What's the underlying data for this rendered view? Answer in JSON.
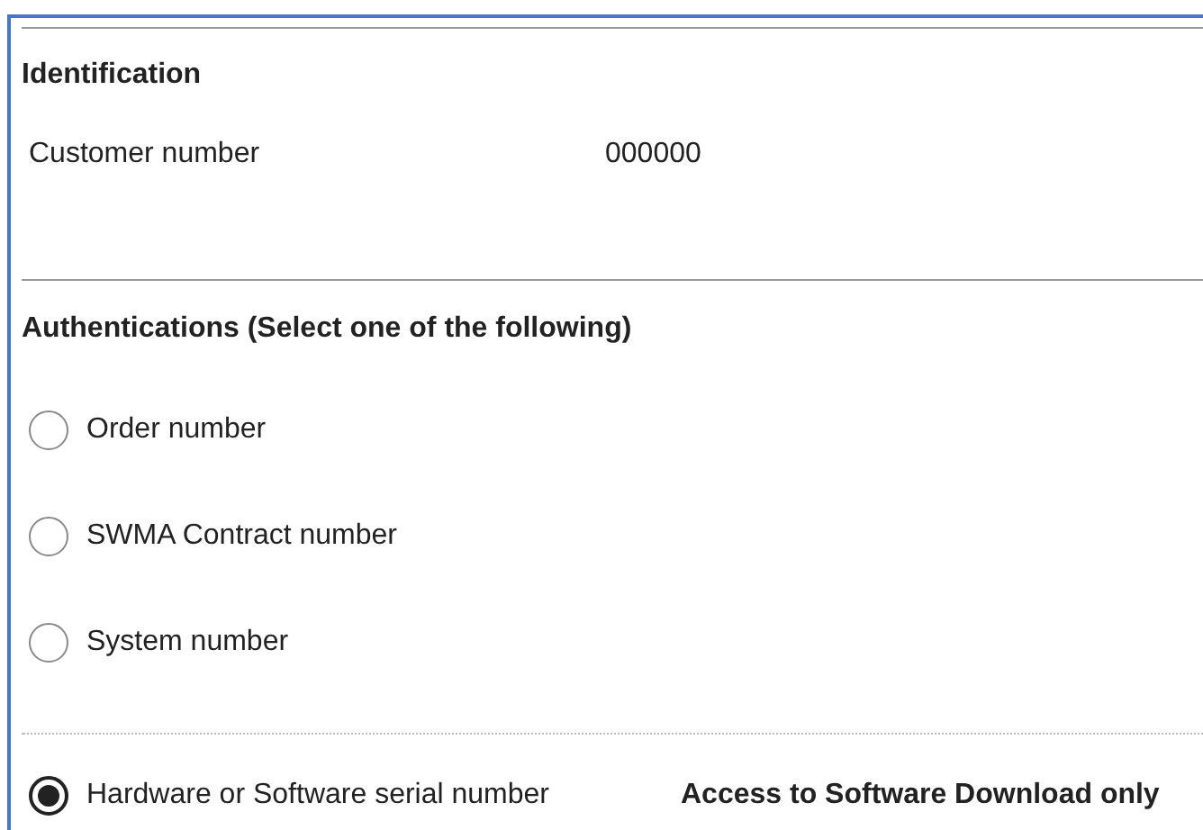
{
  "identification": {
    "heading": "Identification",
    "fields": [
      {
        "label": "Customer number",
        "value": "000000"
      }
    ]
  },
  "authentications": {
    "heading": "Authentications (Select one of the following)",
    "options": [
      {
        "label": "Order number",
        "selected": false
      },
      {
        "label": "SWMA Contract number",
        "selected": false
      },
      {
        "label": "System number",
        "selected": false
      },
      {
        "label": "Hardware or Software serial number",
        "selected": true,
        "note": "Access to Software Download only"
      }
    ]
  }
}
